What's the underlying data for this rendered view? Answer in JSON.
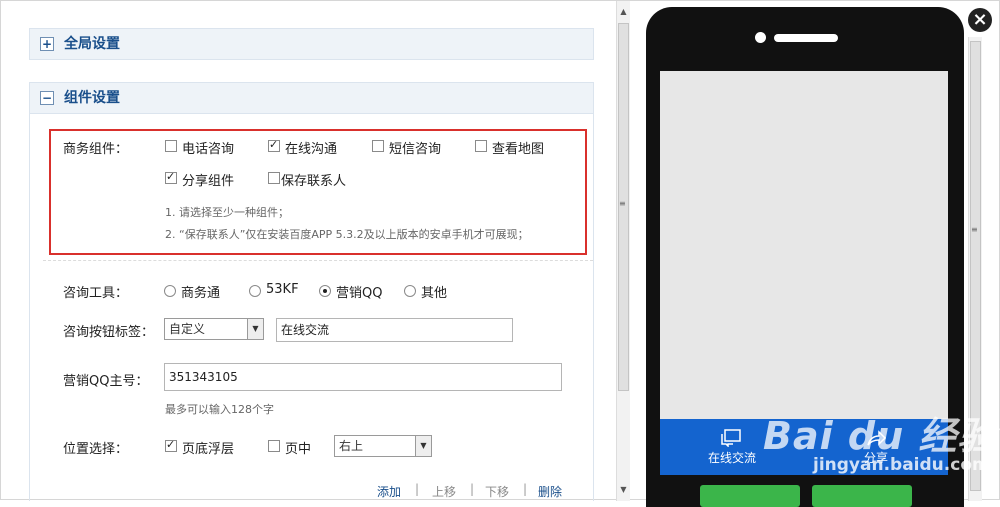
{
  "sections": {
    "global": {
      "label": "全局设置",
      "toggle": "+"
    },
    "component": {
      "label": "组件设置",
      "toggle": "−"
    }
  },
  "business": {
    "label": "商务组件：",
    "options": [
      {
        "label": "电话咨询",
        "checked": false
      },
      {
        "label": "在线沟通",
        "checked": true
      },
      {
        "label": "短信咨询",
        "checked": false
      },
      {
        "label": "查看地图",
        "checked": false
      },
      {
        "label": "分享组件",
        "checked": true
      },
      {
        "label": "保存联系人",
        "checked": false
      }
    ],
    "notes": [
      "1. 请选择至少一种组件；",
      "2. “保存联系人”仅在安装百度APP 5.3.2及以上版本的安卓手机才可展现；"
    ]
  },
  "consult_tool": {
    "label": "咨询工具：",
    "options": [
      {
        "label": "商务通",
        "selected": false
      },
      {
        "label": "53KF",
        "selected": false
      },
      {
        "label": "营销QQ",
        "selected": true
      },
      {
        "label": "其他",
        "selected": false
      }
    ]
  },
  "button_label": {
    "label": "咨询按钮标签：",
    "select_value": "自定义",
    "input_value": "在线交流"
  },
  "qq_main": {
    "label": "营销QQ主号：",
    "input_value": "351343105",
    "hint": "最多可以输入128个字"
  },
  "position": {
    "label": "位置选择：",
    "opt_bottom": {
      "label": "页底浮层",
      "checked": true
    },
    "opt_middle": {
      "label": "页中",
      "checked": false
    },
    "select_value": "右上"
  },
  "actions": {
    "add": "添加",
    "up": "上移",
    "down": "下移",
    "delete": "删除"
  },
  "phone": {
    "bar_left": "在线交流",
    "bar_right": "分享"
  },
  "watermark": {
    "logo": "Bai du 经验",
    "url": "jingyan.baidu.com"
  },
  "colors": {
    "accent": "#1464cf",
    "highlight": "#d9302c",
    "section_bg": "#eef3f8"
  }
}
